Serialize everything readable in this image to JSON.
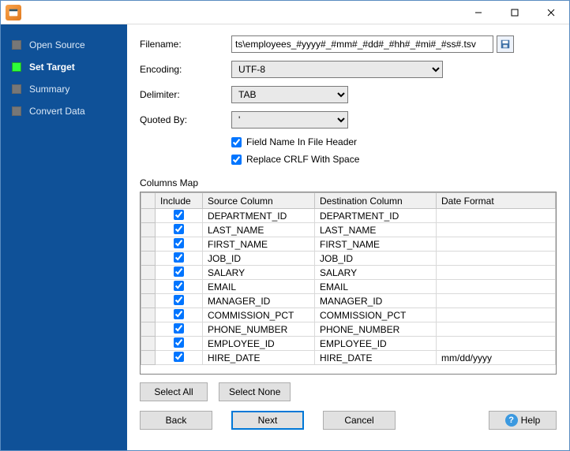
{
  "titlebar": {
    "title": ""
  },
  "sidebar": {
    "items": [
      {
        "label": "Open Source"
      },
      {
        "label": "Set Target"
      },
      {
        "label": "Summary"
      },
      {
        "label": "Convert Data"
      }
    ],
    "active_index": 1
  },
  "form": {
    "filename_label": "Filename:",
    "filename_value": "ts\\employees_#yyyy#_#mm#_#dd#_#hh#_#mi#_#ss#.tsv",
    "encoding_label": "Encoding:",
    "encoding_value": "UTF-8",
    "delimiter_label": "Delimiter:",
    "delimiter_value": "TAB",
    "quoted_label": "Quoted By:",
    "quoted_value": "'",
    "check_header_label": "Field Name In File Header",
    "check_header_checked": true,
    "check_crlf_label": "Replace CRLF With Space",
    "check_crlf_checked": true
  },
  "columns_map": {
    "section_label": "Columns Map",
    "headers": {
      "include": "Include",
      "source": "Source Column",
      "dest": "Destination Column",
      "datefmt": "Date Format"
    },
    "rows": [
      {
        "include": true,
        "source": "DEPARTMENT_ID",
        "dest": "DEPARTMENT_ID",
        "datefmt": ""
      },
      {
        "include": true,
        "source": "LAST_NAME",
        "dest": "LAST_NAME",
        "datefmt": ""
      },
      {
        "include": true,
        "source": "FIRST_NAME",
        "dest": "FIRST_NAME",
        "datefmt": ""
      },
      {
        "include": true,
        "source": "JOB_ID",
        "dest": "JOB_ID",
        "datefmt": ""
      },
      {
        "include": true,
        "source": "SALARY",
        "dest": "SALARY",
        "datefmt": ""
      },
      {
        "include": true,
        "source": "EMAIL",
        "dest": "EMAIL",
        "datefmt": ""
      },
      {
        "include": true,
        "source": "MANAGER_ID",
        "dest": "MANAGER_ID",
        "datefmt": ""
      },
      {
        "include": true,
        "source": "COMMISSION_PCT",
        "dest": "COMMISSION_PCT",
        "datefmt": ""
      },
      {
        "include": true,
        "source": "PHONE_NUMBER",
        "dest": "PHONE_NUMBER",
        "datefmt": ""
      },
      {
        "include": true,
        "source": "EMPLOYEE_ID",
        "dest": "EMPLOYEE_ID",
        "datefmt": ""
      },
      {
        "include": true,
        "source": "HIRE_DATE",
        "dest": "HIRE_DATE",
        "datefmt": "mm/dd/yyyy"
      }
    ]
  },
  "buttons": {
    "select_all": "Select All",
    "select_none": "Select None",
    "back": "Back",
    "next": "Next",
    "cancel": "Cancel",
    "help": "Help"
  }
}
